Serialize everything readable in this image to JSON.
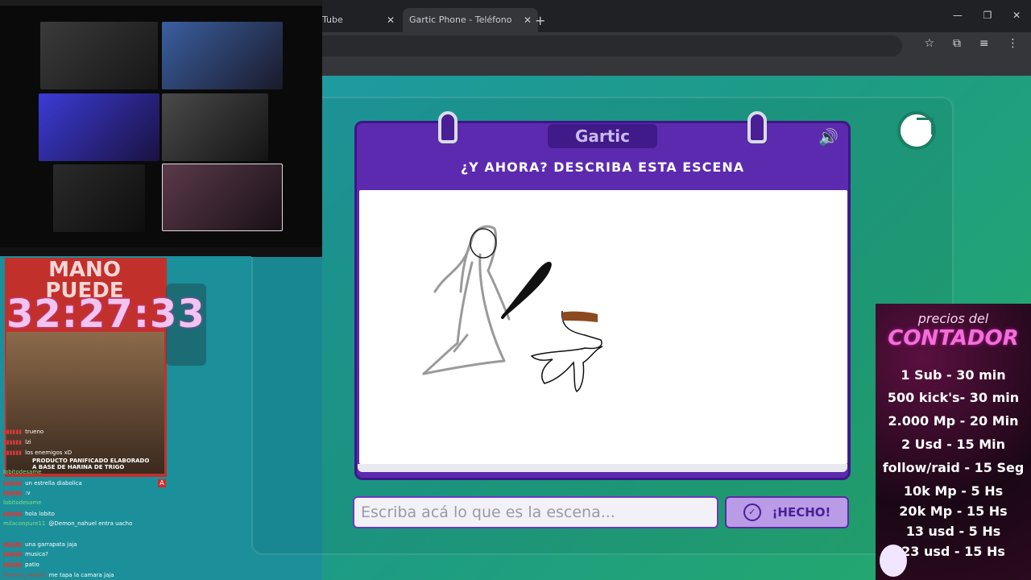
{
  "browser": {
    "tab1_label": "Tube",
    "tab2_label": "Gartic Phone - Teléfono Descon",
    "tab_close": "✕",
    "new_tab": "+",
    "window_controls": [
      "—",
      "❐",
      "✕"
    ],
    "toolbar_icons": [
      "☆",
      "⧉",
      "≡",
      "⋮"
    ]
  },
  "game": {
    "logo": "Gartic",
    "instruction": "¿Y AHORA? DESCRIBA ESTA ESCENA",
    "speaker_icon": "🔊",
    "answer_placeholder": "Escriba acá lo que es la escena...",
    "done_label": "¡HECHO!",
    "done_icon": "✓"
  },
  "stream": {
    "promo_title": "MANO\nPUEDE",
    "clock": "32:27:33",
    "promo_caption": "PRODUCTO PANIFICADO ELABORADO A BASE DE HARINA DE TRIGO",
    "chat": [
      {
        "user": "",
        "msg": "trueno"
      },
      {
        "user": "",
        "msg": "lzi"
      },
      {
        "user": "",
        "msg": "los enemigos xD"
      },
      {
        "user": "lobitodesame",
        "msg": "",
        "green": true
      },
      {
        "user": "",
        "msg": "un estrella diabolica"
      },
      {
        "user": "",
        "msg": ":v"
      },
      {
        "user": "lobitodesame",
        "msg": "",
        "green": true
      },
      {
        "user": "",
        "msg": "hola lobito"
      },
      {
        "user": "milaconpure11",
        "msg": "@Demon_nahuel entra uacho",
        "green": true
      },
      {
        "user": "",
        "msg": ""
      },
      {
        "user": "",
        "msg": "una garrapata jaja"
      },
      {
        "user": "",
        "msg": "musica?"
      },
      {
        "user": "",
        "msg": "patio"
      },
      {
        "user": "Demon_nahuel",
        "msg": "me tapa la camara jaja"
      }
    ],
    "badge": "A"
  },
  "prices": {
    "head1": "precios del",
    "head2": "CONTADOR",
    "items": [
      "1 Sub - 30 min",
      "500 kick's- 30 min",
      "2.000 Mp - 20 Min",
      "2 Usd - 15 Min",
      "follow/raid - 15 Seg",
      "10k Mp - 5 Hs",
      "20k Mp - 15 Hs",
      "13 usd - 5 Hs",
      "23 usd - 15 Hs"
    ]
  },
  "colors": {
    "panel": "#5c2aaf",
    "accent": "#b99be6",
    "background": "#1b8f9a"
  }
}
